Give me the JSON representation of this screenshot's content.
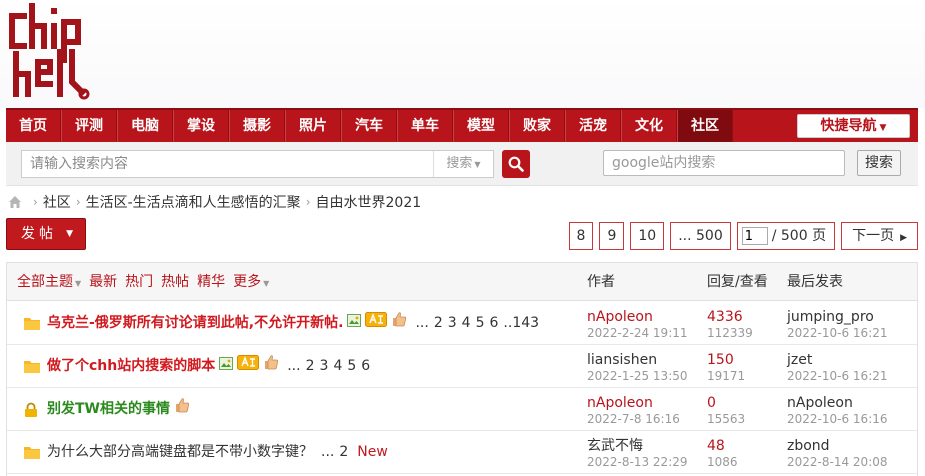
{
  "nav": {
    "items": [
      "首页",
      "评测",
      "电脑",
      "掌设",
      "摄影",
      "照片",
      "汽车",
      "单车",
      "模型",
      "败家",
      "活宠",
      "文化",
      "社区"
    ],
    "quick_nav": "快捷导航"
  },
  "search": {
    "placeholder": "请输入搜索内容",
    "type_label": "搜索",
    "google_placeholder": "google站内搜索",
    "google_button": "搜索"
  },
  "breadcrumb": {
    "items": [
      "社区",
      "生活区-生活点滴和人生感悟的汇聚",
      "自由水世界2021"
    ]
  },
  "post_button": "发帖",
  "pager": {
    "pages": [
      "8",
      "9",
      "10",
      "... 500"
    ],
    "current": "1",
    "total": "/ 500 页",
    "next": "下一页"
  },
  "filters": [
    "全部主题",
    "最新",
    "热门",
    "热帖",
    "精华",
    "更多"
  ],
  "columns": {
    "author": "作者",
    "replies": "回复/查看",
    "last": "最后发表"
  },
  "threads": [
    {
      "title": "乌克兰-俄罗斯所有讨论请到此帖,不允许开新帖.",
      "style": "red",
      "pages": [
        "...",
        "2",
        "3",
        "4",
        "5",
        "6",
        "..143"
      ],
      "author": "nApoleon",
      "date": "2022-2-24 19:11",
      "replies": "4336",
      "views": "112339",
      "last_user": "jumping_pro",
      "last_date": "2022-10-6 16:21"
    },
    {
      "title": "做了个chh站内搜索的脚本",
      "style": "red",
      "pages": [
        "...",
        "2",
        "3",
        "4",
        "5",
        "6"
      ],
      "author": "liansishen",
      "date": "2022-1-25 13:50",
      "replies": "150",
      "views": "19171",
      "last_user": "jzet",
      "last_date": "2022-10-6 16:21"
    },
    {
      "title": "别发TW相关的事情",
      "style": "green",
      "pages": [],
      "author": "nApoleon",
      "date": "2022-7-8 16:16",
      "replies": "0",
      "views": "15563",
      "last_user": "nApoleon",
      "last_date": "2022-10-6 16:16"
    },
    {
      "title": "为什么大部分高端键盘都是不带小数字键？",
      "style": "normal",
      "pages": [
        "...",
        "2"
      ],
      "new_tag": "New",
      "author": "玄武不悔",
      "date": "2022-8-13 22:29",
      "replies": "48",
      "views": "1086",
      "last_user": "zbond",
      "last_date": "2022-8-14 20:08"
    }
  ]
}
